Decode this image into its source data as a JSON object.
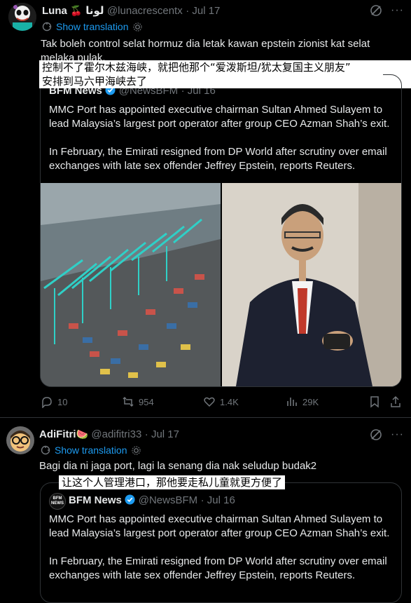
{
  "post1": {
    "display_name": "Luna",
    "name_emoji": "🍒",
    "name_arabic": "لونا",
    "handle": "@lunacrescentx",
    "date": "· Jul 17",
    "show_translation": "Show translation",
    "text": "Tak boleh control selat hormuz dia letak kawan epstein zionist kat selat melaka pulak.",
    "overlay_line1": "控制不了霍尔木兹海峡，就把他那个“爱泼斯坦/犹太复国主义朋友”",
    "overlay_line2": "安排到马六甲海峡去了",
    "quote": {
      "name": "BFM News",
      "handle": "@NewsBFM",
      "date": "· Jul 16",
      "para1": "MMC Port has appointed executive chairman Sultan Ahmed Sulayem to lead Malaysia’s largest port operator after group CEO Azman Shah’s exit.",
      "para2": "In February, the Emirati resigned from DP World after scrutiny over email exchanges with late sex offender Jeffrey Epstein, reports Reuters."
    },
    "stats": {
      "replies": "10",
      "reposts": "954",
      "likes": "1.4K",
      "views": "29K"
    }
  },
  "post2": {
    "display_name": "AdiFitri",
    "name_emoji": "🍉",
    "handle": "@adifitri33",
    "date": "· Jul 17",
    "show_translation": "Show translation",
    "text": "Bagi dia ni jaga port, lagi la senang dia nak seludup budak2",
    "overlay": "让这个人管理港口，那他要走私儿童就更方便了",
    "quote": {
      "logo": "BFM NEWS",
      "name": "BFM News",
      "handle": "@NewsBFM",
      "date": "· Jul 16",
      "para1": "MMC Port has appointed executive chairman Sultan Ahmed Sulayem to lead Malaysia’s largest port operator after group CEO Azman Shah’s exit.",
      "para2": "In February, the Emirati resigned from DP World after scrutiny over email exchanges with late sex offender Jeffrey Epstein, reports Reuters."
    }
  },
  "colors": {
    "background": "#000000",
    "text": "#e7e9ea",
    "muted": "#71767b",
    "link": "#1d9bf0",
    "border": "#2f3336",
    "overlay": "#ffffff"
  },
  "icons": [
    "grok-icon",
    "more-icon",
    "translate-gear-icon",
    "verified-icon",
    "reply-icon",
    "repost-icon",
    "like-icon",
    "views-icon",
    "bookmark-icon",
    "share-icon"
  ]
}
